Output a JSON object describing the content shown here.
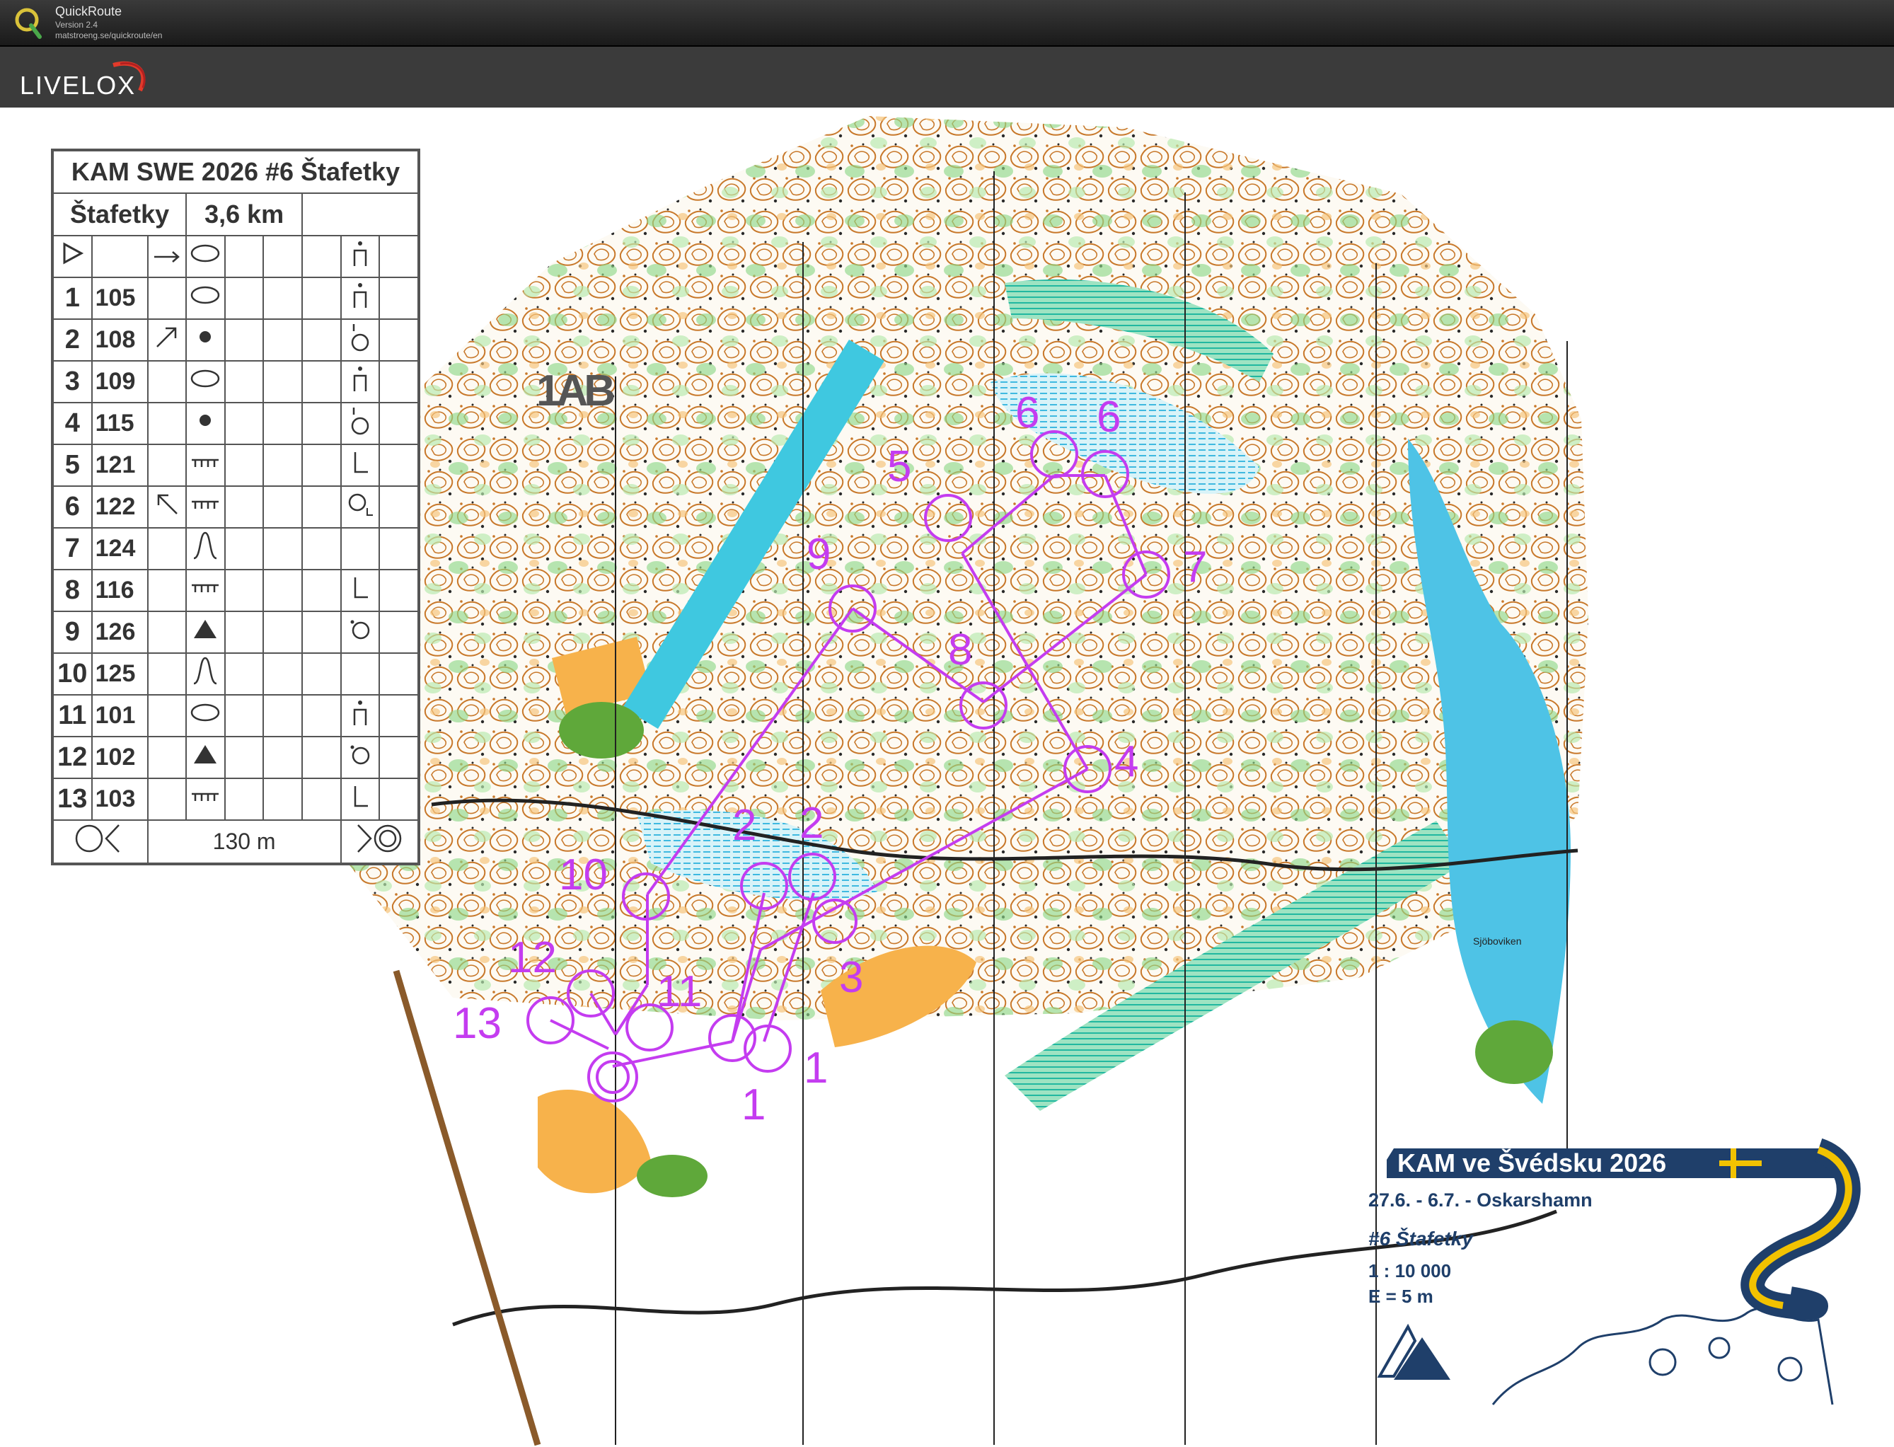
{
  "app": {
    "name": "QuickRoute",
    "version": "Version 2.4",
    "url": "matstroeng.se/quickroute/en",
    "header_logo_text": "LIVELOX"
  },
  "map": {
    "overlay_label": "1AB",
    "place_name": "Sjöboviken"
  },
  "description_sheet": {
    "title": "KAM SWE 2026 #6 Štafetky",
    "class": "Štafetky",
    "length": "3,6 km",
    "rows": [
      {
        "num": "1",
        "code": "105"
      },
      {
        "num": "2",
        "code": "108"
      },
      {
        "num": "3",
        "code": "109"
      },
      {
        "num": "4",
        "code": "115"
      },
      {
        "num": "5",
        "code": "121"
      },
      {
        "num": "6",
        "code": "122"
      },
      {
        "num": "7",
        "code": "124"
      },
      {
        "num": "8",
        "code": "116"
      },
      {
        "num": "9",
        "code": "126"
      },
      {
        "num": "10",
        "code": "125"
      },
      {
        "num": "11",
        "code": "101"
      },
      {
        "num": "12",
        "code": "102"
      },
      {
        "num": "13",
        "code": "103"
      }
    ],
    "finish_distance": "130 m"
  },
  "course_controls": [
    {
      "label": "1"
    },
    {
      "label": "1"
    },
    {
      "label": "2"
    },
    {
      "label": "2"
    },
    {
      "label": "3"
    },
    {
      "label": "4"
    },
    {
      "label": "5"
    },
    {
      "label": "6"
    },
    {
      "label": "6"
    },
    {
      "label": "7"
    },
    {
      "label": "8"
    },
    {
      "label": "9"
    },
    {
      "label": "10"
    },
    {
      "label": "11"
    },
    {
      "label": "12"
    },
    {
      "label": "13"
    }
  ],
  "event_info": {
    "title": "KAM ve Švédsku 2026",
    "dates": "27.6. - 6.7. - Oskarshamn",
    "race": "#6 Štafetky",
    "scale": "1 : 10 000",
    "equidistance": "E = 5 m"
  },
  "colors": {
    "course": "#c43cf0",
    "water": "#4ec3e6",
    "forest_green": "#8ed888",
    "open_land": "#f7b24b",
    "brand_navy": "#1f3f6a",
    "sweden_yellow": "#f2c200"
  }
}
